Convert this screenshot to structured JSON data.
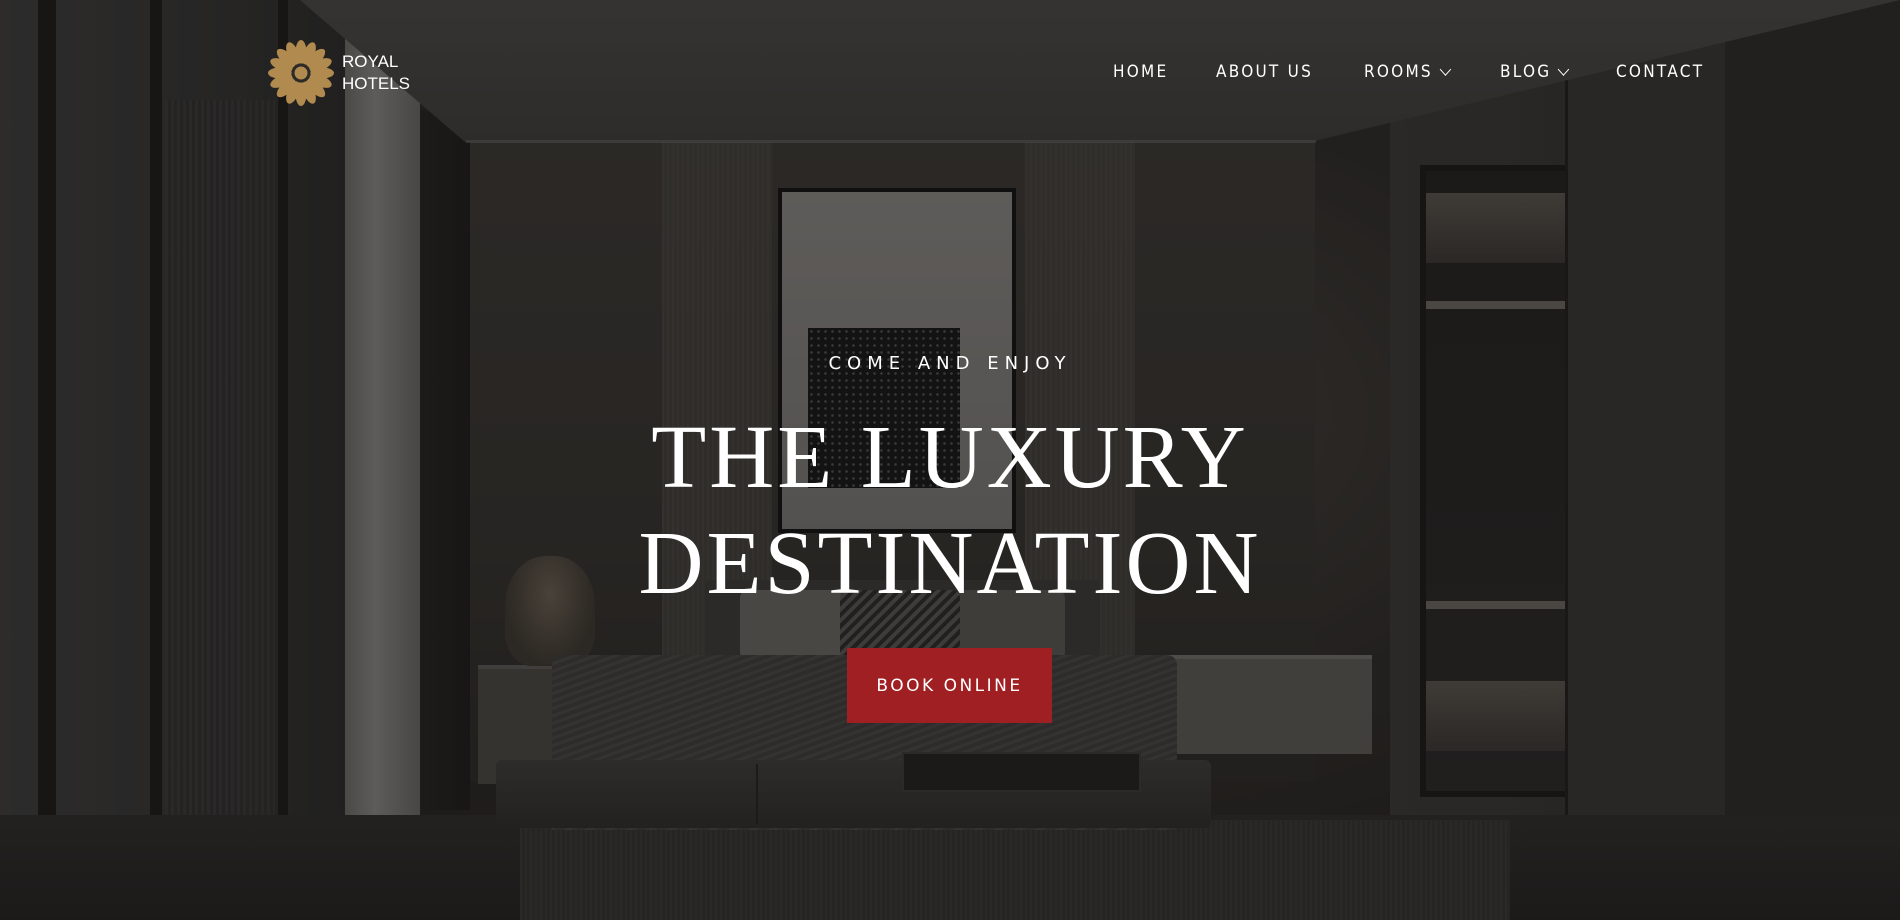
{
  "brand": {
    "line1": "ROYAL",
    "line2": "HOTELS",
    "logo_icon": "flower-icon",
    "logo_color": "#b08a4e"
  },
  "nav": {
    "items": [
      {
        "label": "HOME",
        "has_dropdown": false
      },
      {
        "label": "ABOUT US",
        "has_dropdown": false
      },
      {
        "label": "ROOMS",
        "has_dropdown": true
      },
      {
        "label": "BLOG",
        "has_dropdown": true
      },
      {
        "label": "CONTACT",
        "has_dropdown": false
      }
    ],
    "dropdown_icon": "chevron-down-icon"
  },
  "hero": {
    "eyebrow": "COME AND ENJOY",
    "headline_line1": "THE LUXURY",
    "headline_line2": "DESTINATION",
    "cta_label": "BOOK ONLINE",
    "cta_color": "#a01f22"
  }
}
